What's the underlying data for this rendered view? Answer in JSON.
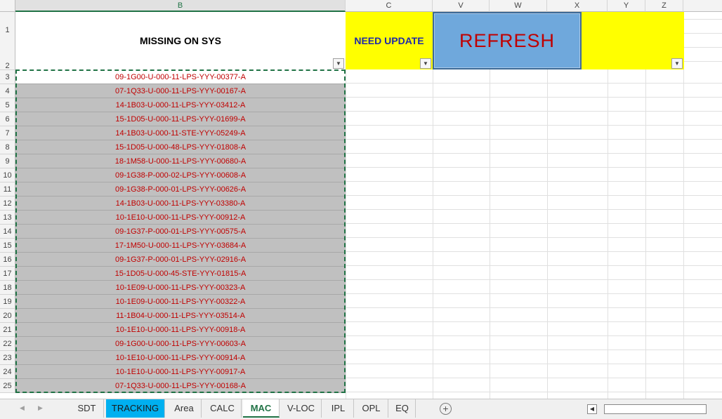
{
  "columns": [
    "B",
    "C",
    "V",
    "W",
    "X",
    "Y",
    "Z"
  ],
  "rows": [
    "1",
    "2",
    "3",
    "4",
    "5",
    "6",
    "7",
    "8",
    "9",
    "10",
    "11",
    "12",
    "13",
    "14",
    "15",
    "16",
    "17",
    "18",
    "19",
    "20",
    "21",
    "22",
    "23",
    "24",
    "25"
  ],
  "header_cells": {
    "b1": "MISSING ON SYS",
    "c1": "NEED UPDATE"
  },
  "refresh_button": {
    "label": "REFRESH"
  },
  "filter_icon": "▼",
  "data_values": [
    "09-1G00-U-000-11-LPS-YYY-00377-A",
    "07-1Q33-U-000-11-LPS-YYY-00167-A",
    "14-1B03-U-000-11-LPS-YYY-03412-A",
    "15-1D05-U-000-11-LPS-YYY-01699-A",
    "14-1B03-U-000-11-STE-YYY-05249-A",
    "15-1D05-U-000-48-LPS-YYY-01808-A",
    "18-1M58-U-000-11-LPS-YYY-00680-A",
    "09-1G38-P-000-02-LPS-YYY-00608-A",
    "09-1G38-P-000-01-LPS-YYY-00626-A",
    "14-1B03-U-000-11-LPS-YYY-03380-A",
    "10-1E10-U-000-11-LPS-YYY-00912-A",
    "09-1G37-P-000-01-LPS-YYY-00575-A",
    "17-1M50-U-000-11-LPS-YYY-03684-A",
    "09-1G37-P-000-01-LPS-YYY-02916-A",
    "15-1D05-U-000-45-STE-YYY-01815-A",
    "10-1E09-U-000-11-LPS-YYY-00323-A",
    "10-1E09-U-000-11-LPS-YYY-00322-A",
    "11-1B04-U-000-11-LPS-YYY-03514-A",
    "10-1E10-U-000-11-LPS-YYY-00918-A",
    "09-1G00-U-000-11-LPS-YYY-00603-A",
    "10-1E10-U-000-11-LPS-YYY-00914-A",
    "10-1E10-U-000-11-LPS-YYY-00917-A",
    "07-1Q33-U-000-11-LPS-YYY-00168-A"
  ],
  "sheet_tabs": [
    "SDT",
    "TRACKING",
    "Area",
    "CALC",
    "MAC",
    "V-LOC",
    "IPL",
    "OPL",
    "EQ"
  ],
  "active_tab": "MAC",
  "colors": {
    "accent": "#217346",
    "yellow_fill": "#ffff00",
    "button_blue": "#6fa8dc",
    "data_text": "#c00000",
    "tracking_tab": "#00b0f0"
  }
}
